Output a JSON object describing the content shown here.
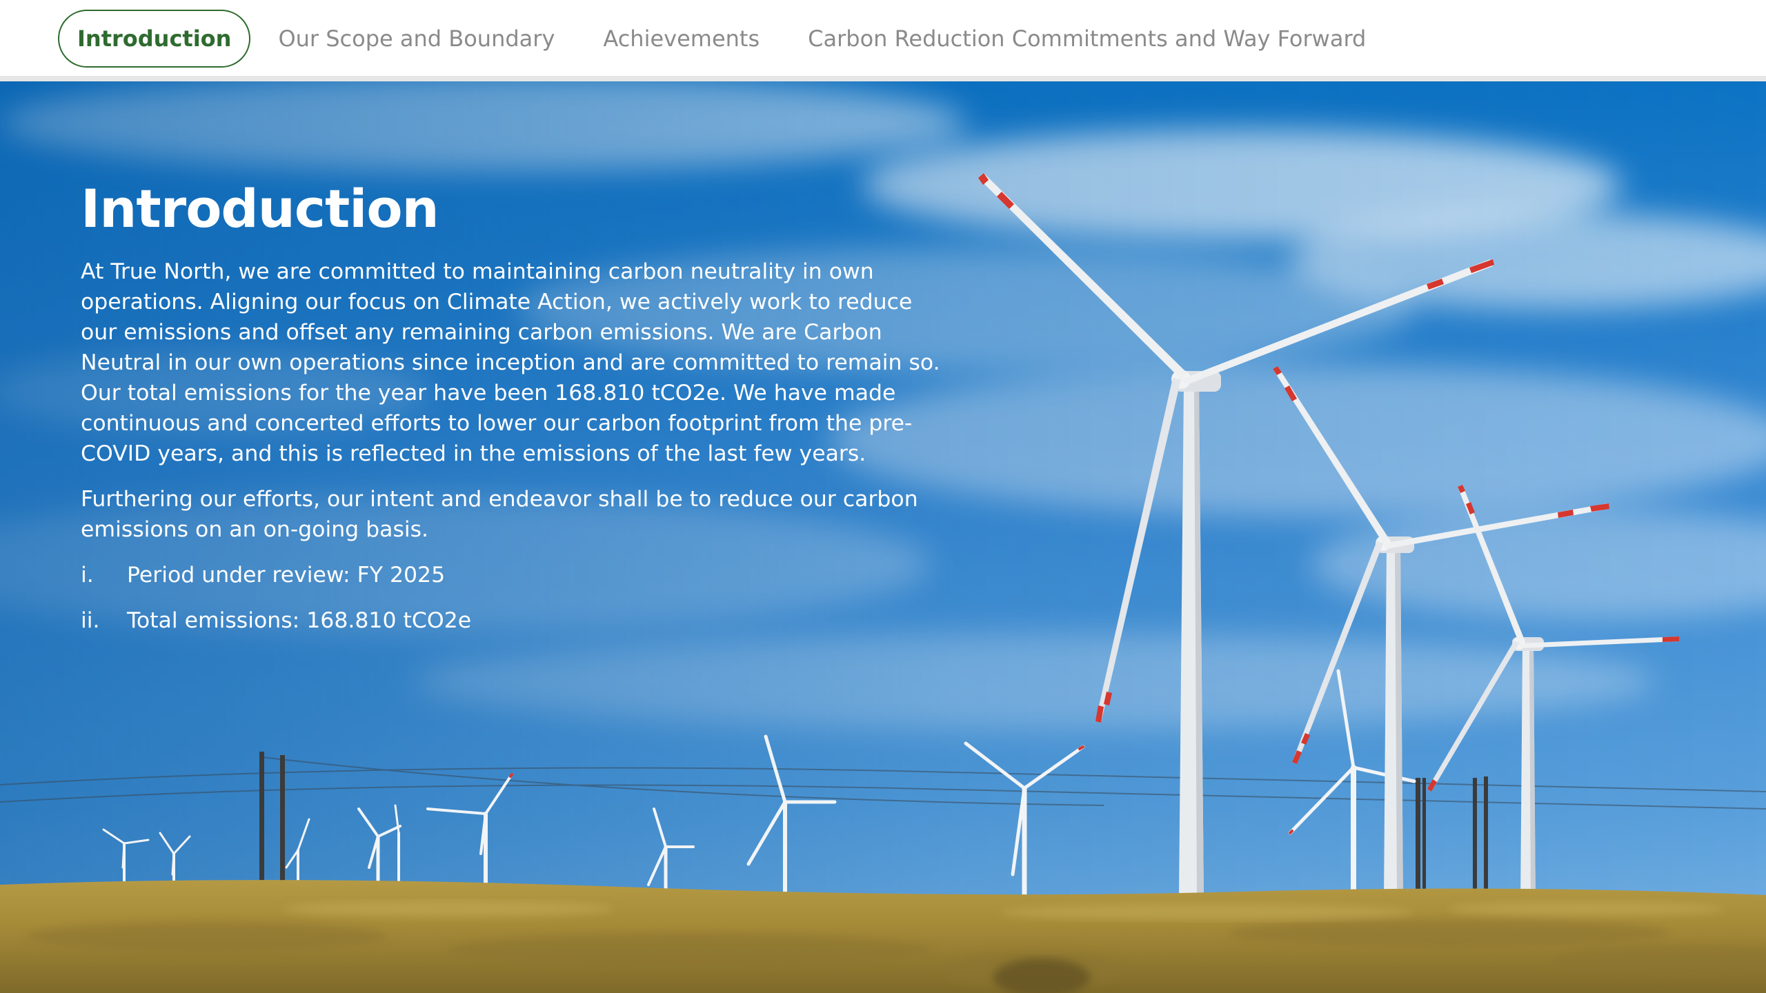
{
  "nav": {
    "tabs": [
      {
        "label": "Introduction",
        "active": true
      },
      {
        "label": "Our Scope and Boundary",
        "active": false
      },
      {
        "label": "Achievements",
        "active": false
      },
      {
        "label": "Carbon Reduction Commitments and Way Forward",
        "active": false
      }
    ],
    "active_color": "#2e6b2f",
    "inactive_color": "#8a8a8a"
  },
  "hero": {
    "background_image": "wind-farm-photo",
    "title": "Introduction",
    "paragraphs": [
      "At True North, we are committed to maintaining carbon neutrality in own operations. Aligning our focus on Climate Action, we actively work to reduce our emissions and offset any remaining carbon emissions. We are Carbon Neutral in our own operations since inception and are committed to remain so. Our total emissions for the year have been 168.810 tCO2e. We have made continuous and concerted efforts to lower our carbon footprint from the pre-COVID years, and this is reflected in the emissions of the last few years.",
      "Furthering our efforts, our intent and endeavor shall be to reduce our carbon emissions on an on-going basis."
    ],
    "list": [
      {
        "marker": "i.",
        "text": "Period under review: FY 2025"
      },
      {
        "marker": "ii.",
        "text": "Total emissions: 168.810 tCO2e"
      }
    ]
  }
}
